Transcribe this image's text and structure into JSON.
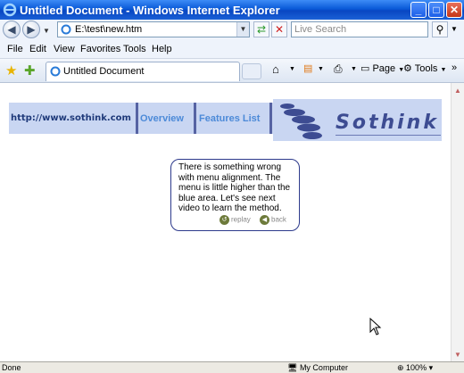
{
  "window": {
    "title": "Untitled Document - Windows Internet Explorer",
    "controls": {
      "minimize": "_",
      "maximize": "□",
      "close": "✕"
    }
  },
  "address_bar": {
    "url": "E:\\test\\new.htm",
    "search_placeholder": "Live Search"
  },
  "menu": [
    "File",
    "Edit",
    "View",
    "Favorites",
    "Tools",
    "Help"
  ],
  "toolbar": {
    "tab_title": "Untitled Document",
    "page_label": "Page",
    "tools_label": "Tools"
  },
  "page": {
    "site_url": "http://www.sothink.com",
    "nav_overview": "Overview",
    "nav_features": "Features List",
    "logo_text": "Sothink",
    "tooltip": {
      "message": "There is something wrong with menu alignment. The menu is little higher than the blue area. Let's see next video to learn the method.",
      "replay": "replay",
      "back": "back"
    }
  },
  "status": {
    "left": "Done",
    "zone": "My Computer",
    "zoom": "100%"
  },
  "colors": {
    "menu_bg": "#c9d6f2",
    "menu_separator": "#5663a3",
    "link": "#4c8ad8",
    "title_bar": "#0a5ad8"
  }
}
